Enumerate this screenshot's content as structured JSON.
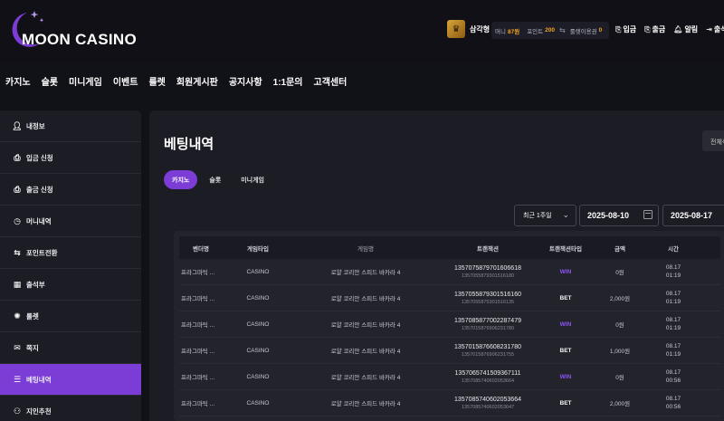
{
  "brand": {
    "name": "MOON CASINO",
    "accent": "#7c3cd6",
    "moon_color": "#7c3cd6"
  },
  "user": {
    "rank_icon": "rank-crown-icon",
    "name": "삼각형",
    "money_label": "머니",
    "money_value": "87원",
    "point_label": "포인트",
    "point_value": "200",
    "coupon_label": "룰렛이용권",
    "coupon_value": "0"
  },
  "top_actions": [
    {
      "icon": "deposit-icon",
      "label": "입금"
    },
    {
      "icon": "withdraw-icon",
      "label": "출금"
    },
    {
      "icon": "bell-icon",
      "label": "알림"
    },
    {
      "icon": "logout-icon",
      "label": "출석부"
    }
  ],
  "nav": [
    "카지노",
    "슬롯",
    "미니게임",
    "이벤트",
    "룰렛",
    "회원게시판",
    "공지사항",
    "1:1문의",
    "고객센터"
  ],
  "sidebar": [
    {
      "icon": "user-icon",
      "label": "내정보"
    },
    {
      "icon": "deposit-icon",
      "label": "입금 신청"
    },
    {
      "icon": "withdraw-icon",
      "label": "출금 신청"
    },
    {
      "icon": "clock-icon",
      "label": "머니내역"
    },
    {
      "icon": "swap-icon",
      "label": "포인트전환"
    },
    {
      "icon": "calendar-icon",
      "label": "출석부"
    },
    {
      "icon": "roulette-icon",
      "label": "룰렛"
    },
    {
      "icon": "mail-icon",
      "label": "쪽지"
    },
    {
      "icon": "list-icon",
      "label": "베팅내역"
    },
    {
      "icon": "people-icon",
      "label": "지인추천"
    }
  ],
  "main": {
    "title": "베팅내역",
    "all_button": "전체삭제",
    "tabs": [
      "카지노",
      "슬롯",
      "미니게임"
    ],
    "period": "최근 1주일",
    "date_from": "2025-08-10",
    "date_to": "2025-08-17",
    "columns": [
      "벤더명",
      "게임타입",
      "게임명",
      "트랜잭션",
      "트랜잭션타입",
      "금액",
      "시간"
    ],
    "rows": [
      {
        "vendor": "프라그마틱 ...",
        "type": "CASINO",
        "game": "로얄 코리안 스피드 바카라 4",
        "tx": "1357075879701606618",
        "tx_sub": "1357055879301516180",
        "tx_type": "WIN",
        "amount": "0원",
        "date": "08.17",
        "time": "01:19"
      },
      {
        "vendor": "프라그마틱 ...",
        "type": "CASINO",
        "game": "로얄 코리안 스피드 바카라 4",
        "tx": "1357055879301516160",
        "tx_sub": "1357055875301516135",
        "tx_type": "BET",
        "amount": "2,000원",
        "date": "08.17",
        "time": "01:19"
      },
      {
        "vendor": "프라그마틱 ...",
        "type": "CASINO",
        "game": "로얄 코리안 스피드 바카라 4",
        "tx": "1357085877002287479",
        "tx_sub": "1357015876906231780",
        "tx_type": "WIN",
        "amount": "0원",
        "date": "08.17",
        "time": "01:19"
      },
      {
        "vendor": "프라그마틱 ...",
        "type": "CASINO",
        "game": "로얄 코리안 스피드 바카라 4",
        "tx": "1357015876608231780",
        "tx_sub": "1357015876906231755",
        "tx_type": "BET",
        "amount": "1,000원",
        "date": "08.17",
        "time": "01:19"
      },
      {
        "vendor": "프라그마틱 ...",
        "type": "CASINO",
        "game": "로얄 코리안 스피드 바카라 4",
        "tx": "1357065741509367111",
        "tx_sub": "1357085740602053664",
        "tx_type": "WIN",
        "amount": "0원",
        "date": "08.17",
        "time": "00:56"
      },
      {
        "vendor": "프라그마틱 ...",
        "type": "CASINO",
        "game": "로얄 코리안 스피드 바카라 4",
        "tx": "1357085740602053664",
        "tx_sub": "1357085740602053647",
        "tx_type": "BET",
        "amount": "2,000원",
        "date": "08.17",
        "time": "00:56"
      }
    ]
  }
}
